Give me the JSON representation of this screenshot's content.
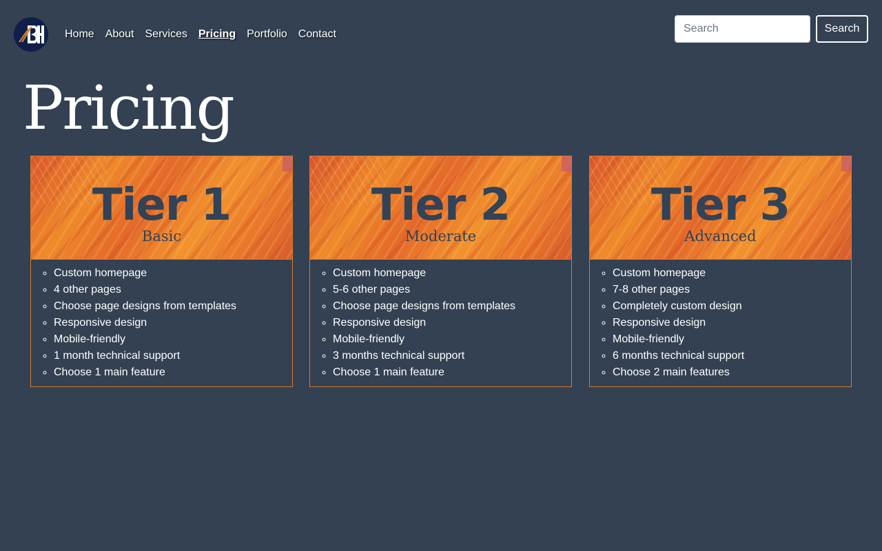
{
  "header": {
    "logo_name": "logo-icon",
    "nav": [
      {
        "label": "Home",
        "active": false
      },
      {
        "label": "About",
        "active": false
      },
      {
        "label": "Services",
        "active": false
      },
      {
        "label": "Pricing",
        "active": true
      },
      {
        "label": "Portfolio",
        "active": false
      },
      {
        "label": "Contact",
        "active": false
      }
    ],
    "search": {
      "placeholder": "Search",
      "value": "",
      "button_label": "Search"
    }
  },
  "page": {
    "title": "Pricing"
  },
  "tiers": [
    {
      "name": "Tier 1",
      "level": "Basic",
      "features": [
        "Custom homepage",
        "4 other pages",
        "Choose page designs from templates",
        "Responsive design",
        "Mobile-friendly",
        "1 month technical support",
        "Choose 1 main feature"
      ]
    },
    {
      "name": "Tier 2",
      "level": "Moderate",
      "features": [
        "Custom homepage",
        "5-6 other pages",
        "Choose page designs from templates",
        "Responsive design",
        "Mobile-friendly",
        "3 months technical support",
        "Choose 1 main feature"
      ]
    },
    {
      "name": "Tier 3",
      "level": "Advanced",
      "features": [
        "Custom homepage",
        "7-8 other pages",
        "Completely custom design",
        "Responsive design",
        "Mobile-friendly",
        "6 months technical support",
        "Choose 2 main features"
      ]
    }
  ],
  "colors": {
    "background": "#334152",
    "accent_border": "#d87a2c",
    "banner_orange": "#ef8a2a",
    "banner_text": "#324257"
  }
}
